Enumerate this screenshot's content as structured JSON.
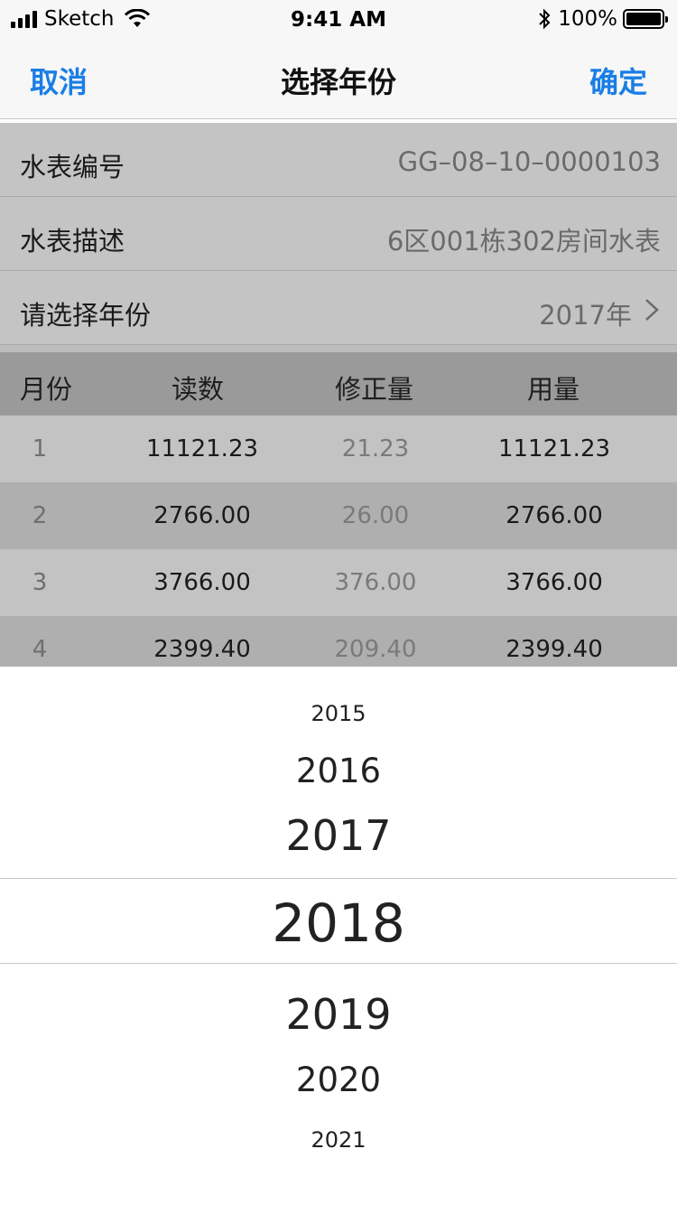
{
  "status_bar": {
    "carrier": "Sketch",
    "time": "9:41 AM",
    "battery": "100%"
  },
  "nav": {
    "cancel": "取消",
    "title": "选择年份",
    "confirm": "确定"
  },
  "info": {
    "meter_no_label": "水表编号",
    "meter_no_value": "GG–08–10–0000103",
    "meter_desc_label": "水表描述",
    "meter_desc_value": "6区001栋302房间水表",
    "year_label": "请选择年份",
    "year_value": "2017年"
  },
  "table": {
    "headers": [
      "月份",
      "读数",
      "修正量",
      "用量"
    ],
    "rows": [
      {
        "month": "1",
        "reading": "11121.23",
        "correction": "21.23",
        "usage": "11121.23"
      },
      {
        "month": "2",
        "reading": "2766.00",
        "correction": "26.00",
        "usage": "2766.00"
      },
      {
        "month": "3",
        "reading": "3766.00",
        "correction": "376.00",
        "usage": "3766.00"
      },
      {
        "month": "4",
        "reading": "2399.40",
        "correction": "209.40",
        "usage": "2399.40"
      }
    ]
  },
  "picker": {
    "years": [
      "2015",
      "2016",
      "2017",
      "2018",
      "2019",
      "2020",
      "2021"
    ],
    "selected": "2018"
  },
  "colors": {
    "accent": "#1a7ee6",
    "dim_overlay": "#c6c6c6"
  }
}
